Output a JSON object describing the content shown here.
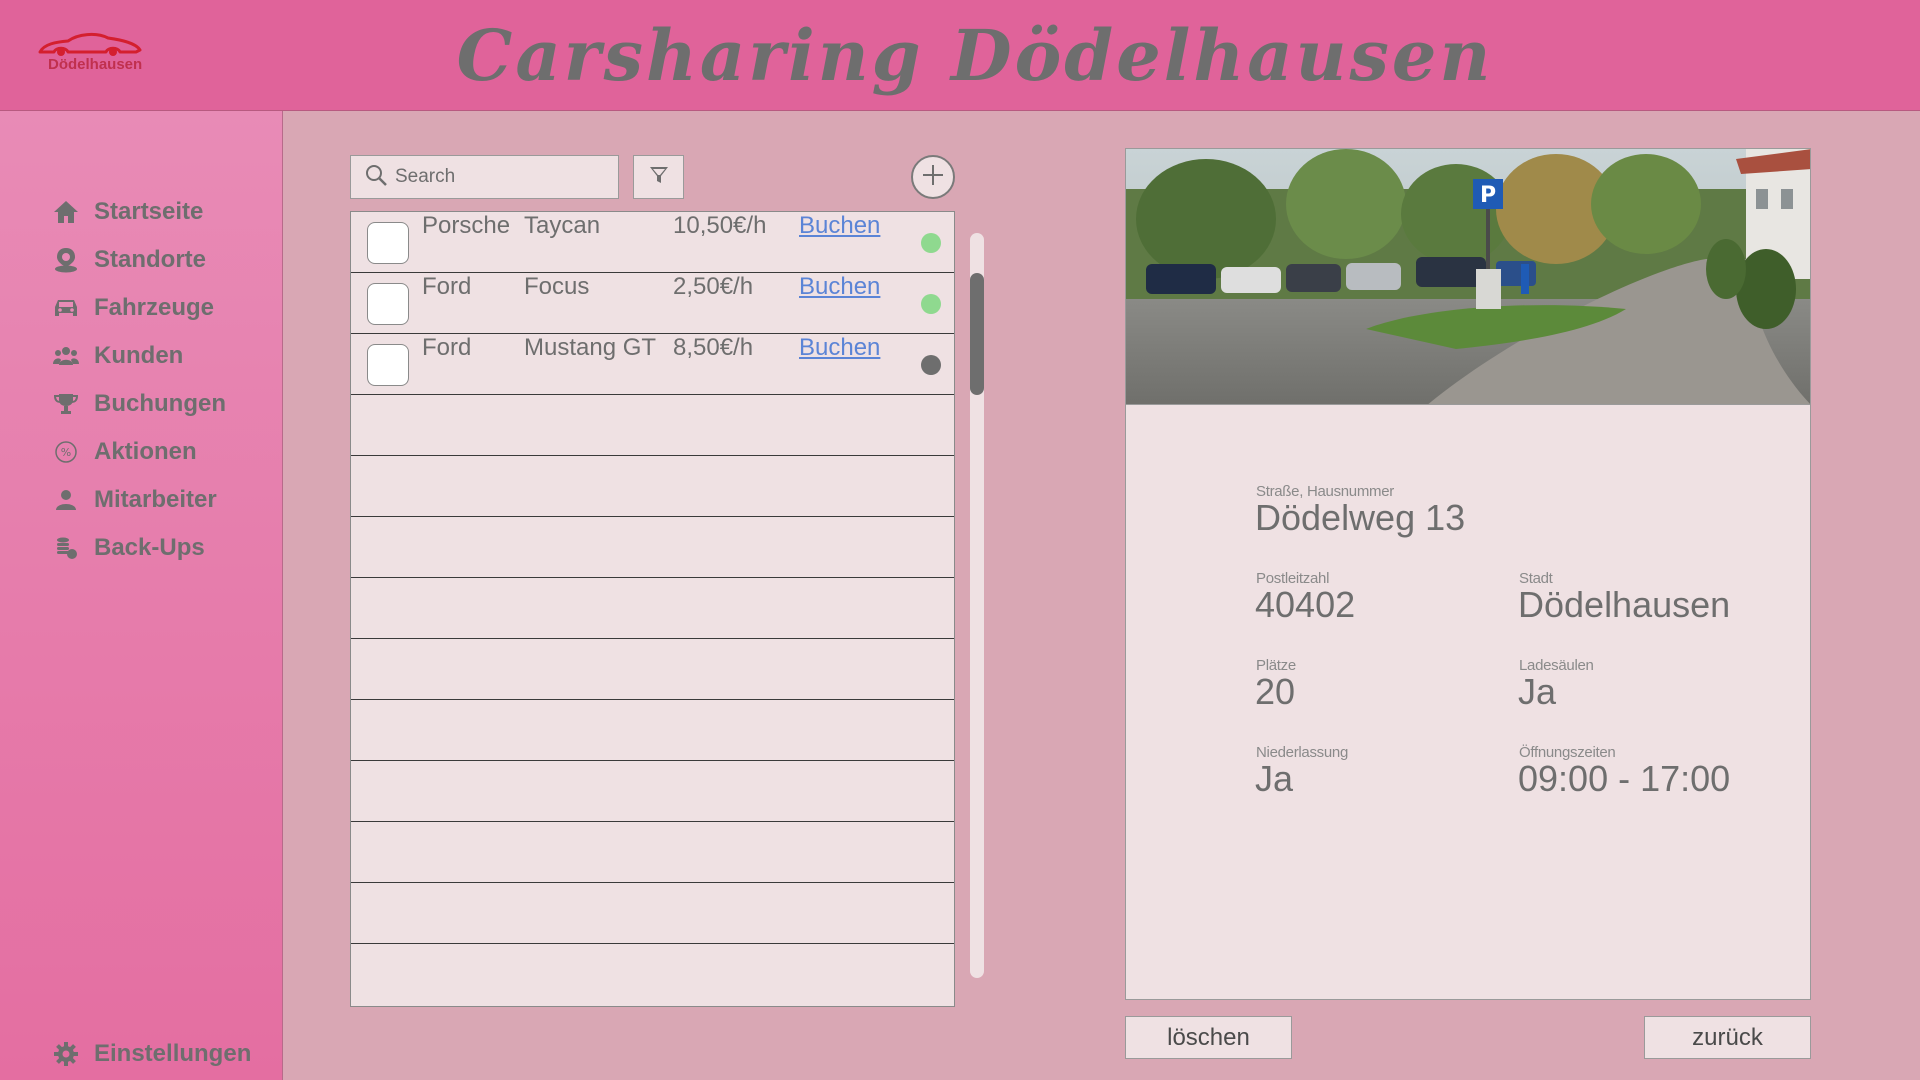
{
  "header": {
    "title": "Carsharing Dödelhausen",
    "logo_text": "Dödelhausen"
  },
  "sidebar": {
    "items": [
      {
        "label": "Startseite",
        "icon": "home-icon"
      },
      {
        "label": "Standorte",
        "icon": "location-pin-icon"
      },
      {
        "label": "Fahrzeuge",
        "icon": "car-icon"
      },
      {
        "label": "Kunden",
        "icon": "users-icon"
      },
      {
        "label": "Buchungen",
        "icon": "trophy-icon"
      },
      {
        "label": "Aktionen",
        "icon": "percent-badge-icon"
      },
      {
        "label": "Mitarbeiter",
        "icon": "user-icon"
      },
      {
        "label": "Back-Ups",
        "icon": "coins-icon"
      }
    ],
    "settings_label": "Einstellungen"
  },
  "list": {
    "search_placeholder": "Search",
    "rows": [
      {
        "make": "Porsche",
        "model": "Taycan",
        "price": "10,50€/h",
        "book": "Buchen",
        "status": "available"
      },
      {
        "make": "Ford",
        "model": "Focus",
        "price": "2,50€/h",
        "book": "Buchen",
        "status": "available"
      },
      {
        "make": "Ford",
        "model": "Mustang GT",
        "price": "8,50€/h",
        "book": "Buchen",
        "status": "unavailable"
      }
    ],
    "empty_rows": 10
  },
  "colors": {
    "status_available": "#8fd98f",
    "status_unavailable": "#6e6e6e",
    "link": "#5b84d6",
    "header": "#e0639a"
  },
  "detail": {
    "street_label": "Straße, Hausnummer",
    "street_value": "Dödelweg 13",
    "zip_label": "Postleitzahl",
    "zip_value": "40402",
    "city_label": "Stadt",
    "city_value": "Dödelhausen",
    "spots_label": "Plätze",
    "spots_value": "20",
    "charging_label": "Ladesäulen",
    "charging_value": "Ja",
    "branch_label": "Niederlassung",
    "branch_value": "Ja",
    "hours_label": "Öffnungszeiten",
    "hours_value": "09:00 - 17:00",
    "parking_sign": "P"
  },
  "actions": {
    "delete_label": "löschen",
    "back_label": "zurück"
  }
}
